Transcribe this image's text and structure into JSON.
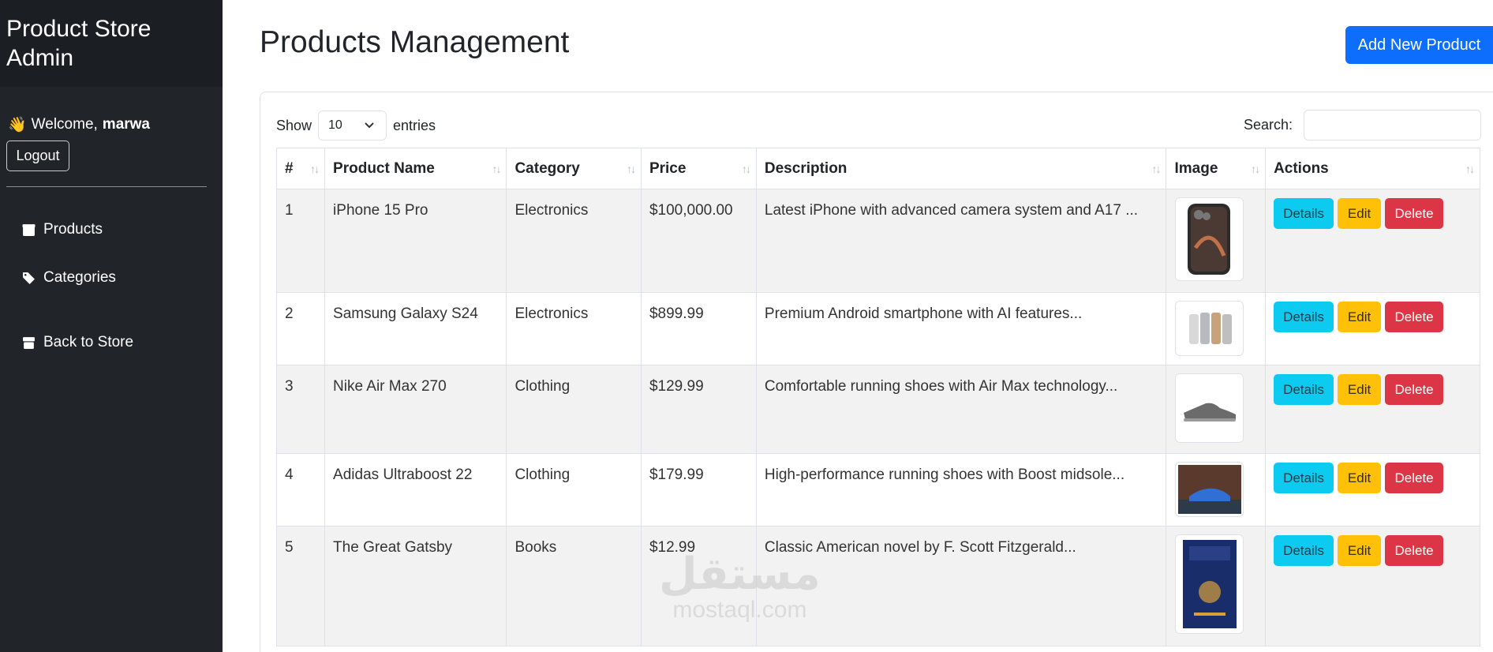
{
  "sidebar": {
    "brand": "Product Store Admin",
    "welcome_prefix": "Welcome,",
    "username": "marwa",
    "logout_label": "Logout",
    "nav": [
      {
        "label": "Products",
        "icon": "box-icon"
      },
      {
        "label": "Categories",
        "icon": "tags-icon"
      },
      {
        "label": "Back to Store",
        "icon": "store-icon"
      }
    ]
  },
  "header": {
    "title": "Products Management",
    "add_button": "Add New Product"
  },
  "table_controls": {
    "show_label": "Show",
    "entries_value": "10",
    "entries_label": "entries",
    "search_label": "Search:",
    "search_value": ""
  },
  "columns": [
    "#",
    "Product Name",
    "Category",
    "Price",
    "Description",
    "Image",
    "Actions"
  ],
  "rows": [
    {
      "id": "1",
      "name": "iPhone 15 Pro",
      "category": "Electronics",
      "price": "$100,000.00",
      "description": "Latest iPhone with advanced camera system and A17 ...",
      "image": "iphone-image"
    },
    {
      "id": "2",
      "name": "Samsung Galaxy S24",
      "category": "Electronics",
      "price": "$899.99",
      "description": "Premium Android smartphone with AI features...",
      "image": "galaxy-image"
    },
    {
      "id": "3",
      "name": "Nike Air Max 270",
      "category": "Clothing",
      "price": "$129.99",
      "description": "Comfortable running shoes with Air Max technology...",
      "image": "shoe-image"
    },
    {
      "id": "4",
      "name": "Adidas Ultraboost 22",
      "category": "Clothing",
      "price": "$179.99",
      "description": "High-performance running shoes with Boost midsole...",
      "image": "sneaker-image"
    },
    {
      "id": "5",
      "name": "The Great Gatsby",
      "category": "Books",
      "price": "$12.99",
      "description": "Classic American novel by F. Scott Fitzgerald...",
      "image": "book-cover-image"
    }
  ],
  "actions": {
    "details": "Details",
    "edit": "Edit",
    "delete": "Delete"
  },
  "watermark": {
    "arabic": "مستقل",
    "latin": "mostaql.com"
  },
  "colors": {
    "primary": "#0d6efd",
    "info": "#0dcaf0",
    "warning": "#ffc107",
    "danger": "#dc3545",
    "sidebar": "#212529"
  }
}
